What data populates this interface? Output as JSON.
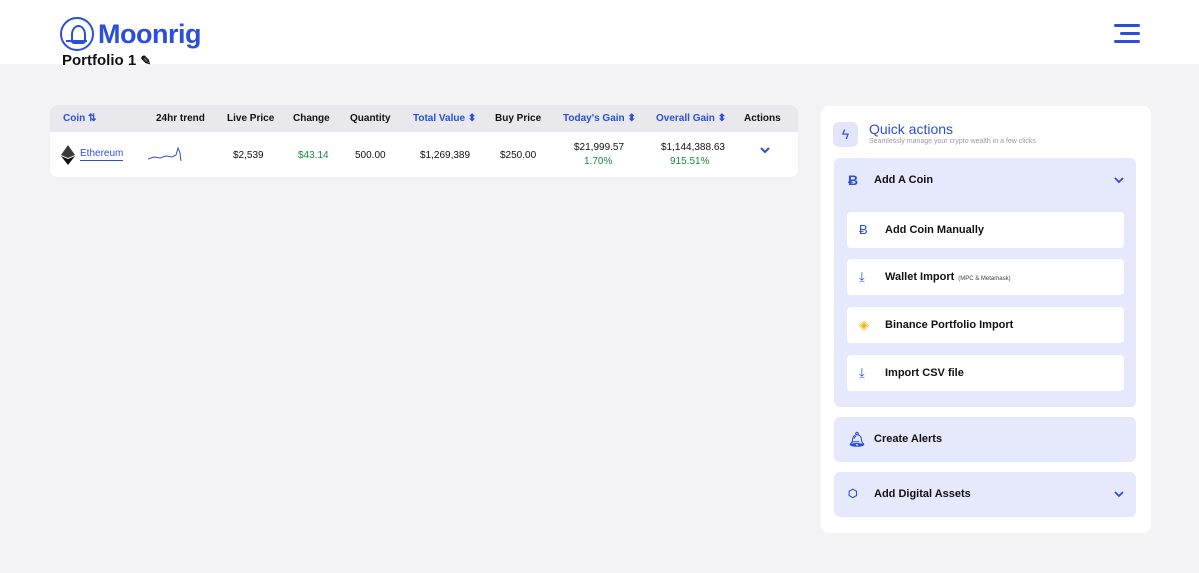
{
  "header": {
    "brand": "Moonrig",
    "menu_icon": "hamburger-menu-icon"
  },
  "portfolio": {
    "title": "Portfolio 1",
    "edit_icon": "pencil-icon"
  },
  "table": {
    "headers": {
      "coin": "Coin",
      "trend": "24hr trend",
      "live_price": "Live Price",
      "change": "Change",
      "quantity": "Quantity",
      "total_value": "Total Value",
      "buy_price": "Buy Price",
      "todays_gain": "Today's Gain",
      "overall_gain": "Overall Gain",
      "actions": "Actions"
    },
    "sort_icons": {
      "coin": "⇅",
      "other": "⬍"
    },
    "rows": [
      {
        "coin": "Ethereum",
        "coin_icon": "ethereum-icon",
        "live_price": "$2,539",
        "change": "$43.14",
        "quantity": "500.00",
        "total_value": "$1,269,389",
        "buy_price": "$250.00",
        "todays_gain": "$21,999.57",
        "todays_gain_pct": "1.70%",
        "overall_gain": "$1,144,388.63",
        "overall_gain_pct": "915.51%"
      }
    ]
  },
  "quick_actions": {
    "title": "Quick actions",
    "subtitle": "Seamlessly manage your crypto wealth in a few clicks",
    "add_coin": {
      "label": "Add A Coin",
      "items": [
        {
          "label": "Add Coin Manually",
          "icon": "bitcoin-icon"
        },
        {
          "label": "Wallet Import",
          "note": "(MPC & Metamask)",
          "icon": "download-icon"
        },
        {
          "label": "Binance Portfolio Import",
          "icon": "binance-icon"
        },
        {
          "label": "Import CSV file",
          "icon": "download-icon"
        }
      ]
    },
    "create_alerts": {
      "label": "Create Alerts"
    },
    "digital_assets": {
      "label": "Add Digital Assets"
    }
  },
  "colors": {
    "brand": "#2b4fd8",
    "gain_green": "#1a8a3c",
    "panel_tint": "#e6e9fb"
  }
}
